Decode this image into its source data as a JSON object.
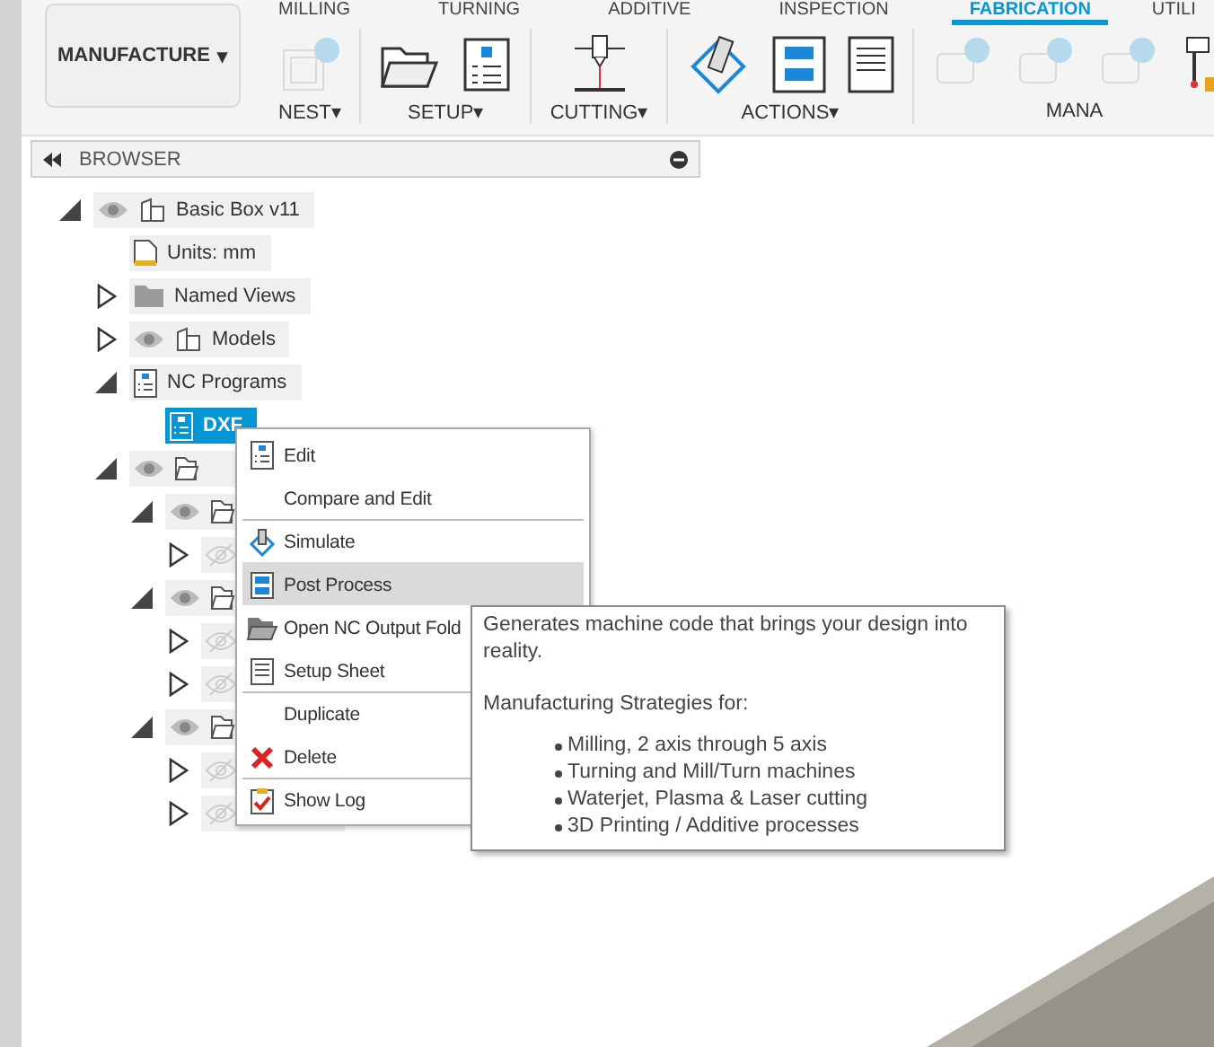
{
  "workspace_button": {
    "label": "MANUFACTURE",
    "caret": "▾"
  },
  "tabs": [
    {
      "label": "MILLING",
      "selected": false
    },
    {
      "label": "TURNING",
      "selected": false
    },
    {
      "label": "ADDITIVE",
      "selected": false
    },
    {
      "label": "INSPECTION",
      "selected": false
    },
    {
      "label": "FABRICATION",
      "selected": true
    },
    {
      "label": "UTILI",
      "selected": false
    }
  ],
  "tool_groups": [
    {
      "label": "NEST▾",
      "tools": [
        {
          "kind": "nest",
          "disabled": true
        }
      ]
    },
    {
      "label": "SETUP▾",
      "tools": [
        {
          "kind": "setup",
          "disabled": false
        },
        {
          "kind": "nc-program",
          "disabled": false
        }
      ]
    },
    {
      "label": "CUTTING▾",
      "tools": [
        {
          "kind": "cutting",
          "disabled": false
        }
      ]
    },
    {
      "label": "ACTIONS▾",
      "tools": [
        {
          "kind": "simulate",
          "disabled": false
        },
        {
          "kind": "post",
          "disabled": false
        },
        {
          "kind": "sheet",
          "disabled": false
        }
      ]
    },
    {
      "label": "MANA",
      "tools": [
        {
          "kind": "manage",
          "disabled": true
        },
        {
          "kind": "manage",
          "disabled": true
        },
        {
          "kind": "manage",
          "disabled": true
        },
        {
          "kind": "probe",
          "disabled": false
        }
      ]
    }
  ],
  "browser": {
    "title": "BROWSER",
    "tree": [
      {
        "label": "Basic Box v11",
        "kind": "component",
        "expanded": true,
        "visible": true,
        "selected": false,
        "children": [
          {
            "label": "Units: mm",
            "kind": "units",
            "selected": false
          },
          {
            "label": "Named Views",
            "kind": "folder",
            "expanded": false,
            "selected": false
          },
          {
            "label": "Models",
            "kind": "component",
            "expanded": false,
            "visible": true,
            "selected": false
          },
          {
            "label": "NC Programs",
            "kind": "nc",
            "expanded": true,
            "selected": false,
            "children": [
              {
                "label": "DXF",
                "kind": "nc",
                "selected": true
              }
            ]
          },
          {
            "kind": "setup",
            "expanded": true,
            "visible": true,
            "selected": false,
            "children": [
              {
                "kind": "setup",
                "expanded": true,
                "visible": true,
                "selected": false,
                "children": [
                  {
                    "expanded": false,
                    "visible": false,
                    "selected": false
                  }
                ]
              },
              {
                "kind": "setup",
                "expanded": true,
                "visible": true,
                "selected": false,
                "children": [
                  {
                    "expanded": false,
                    "visible": false,
                    "selected": false
                  },
                  {
                    "expanded": false,
                    "visible": false,
                    "selected": false
                  }
                ]
              },
              {
                "kind": "setup",
                "expanded": true,
                "visible": true,
                "selected": false,
                "children": [
                  {
                    "expanded": false,
                    "visible": false,
                    "selected": false
                  },
                  {
                    "expanded": false,
                    "visible": false,
                    "selected": false
                  }
                ]
              }
            ]
          }
        ]
      }
    ]
  },
  "context_menu": [
    {
      "label": "Edit",
      "kind": "nc",
      "divider_before": false,
      "selected": false
    },
    {
      "label": "Compare and Edit",
      "kind": "plain",
      "divider_before": false,
      "selected": false
    },
    {
      "label": "Simulate",
      "kind": "simulate",
      "divider_before": true,
      "selected": false
    },
    {
      "label": "Post Process",
      "kind": "post",
      "divider_before": false,
      "selected": true
    },
    {
      "label": "Open NC Output Fold",
      "kind": "folder-open",
      "divider_before": false,
      "selected": false
    },
    {
      "label": "Setup Sheet",
      "kind": "sheet",
      "divider_before": false,
      "selected": false
    },
    {
      "label": "Duplicate",
      "kind": "plain",
      "divider_before": true,
      "selected": false
    },
    {
      "label": "Delete",
      "kind": "delete",
      "divider_before": false,
      "selected": false
    },
    {
      "label": "Show Log",
      "kind": "log",
      "divider_before": true,
      "selected": false
    }
  ],
  "tooltip": {
    "description": "Generates machine code that brings your design into reality.",
    "heading": "Manufacturing Strategies for:",
    "bullets": [
      "Milling, 2 axis through 5 axis",
      "Turning and Mill/Turn machines",
      "Waterjet, Plasma & Laser cutting",
      "3D Printing / Additive processes"
    ]
  }
}
